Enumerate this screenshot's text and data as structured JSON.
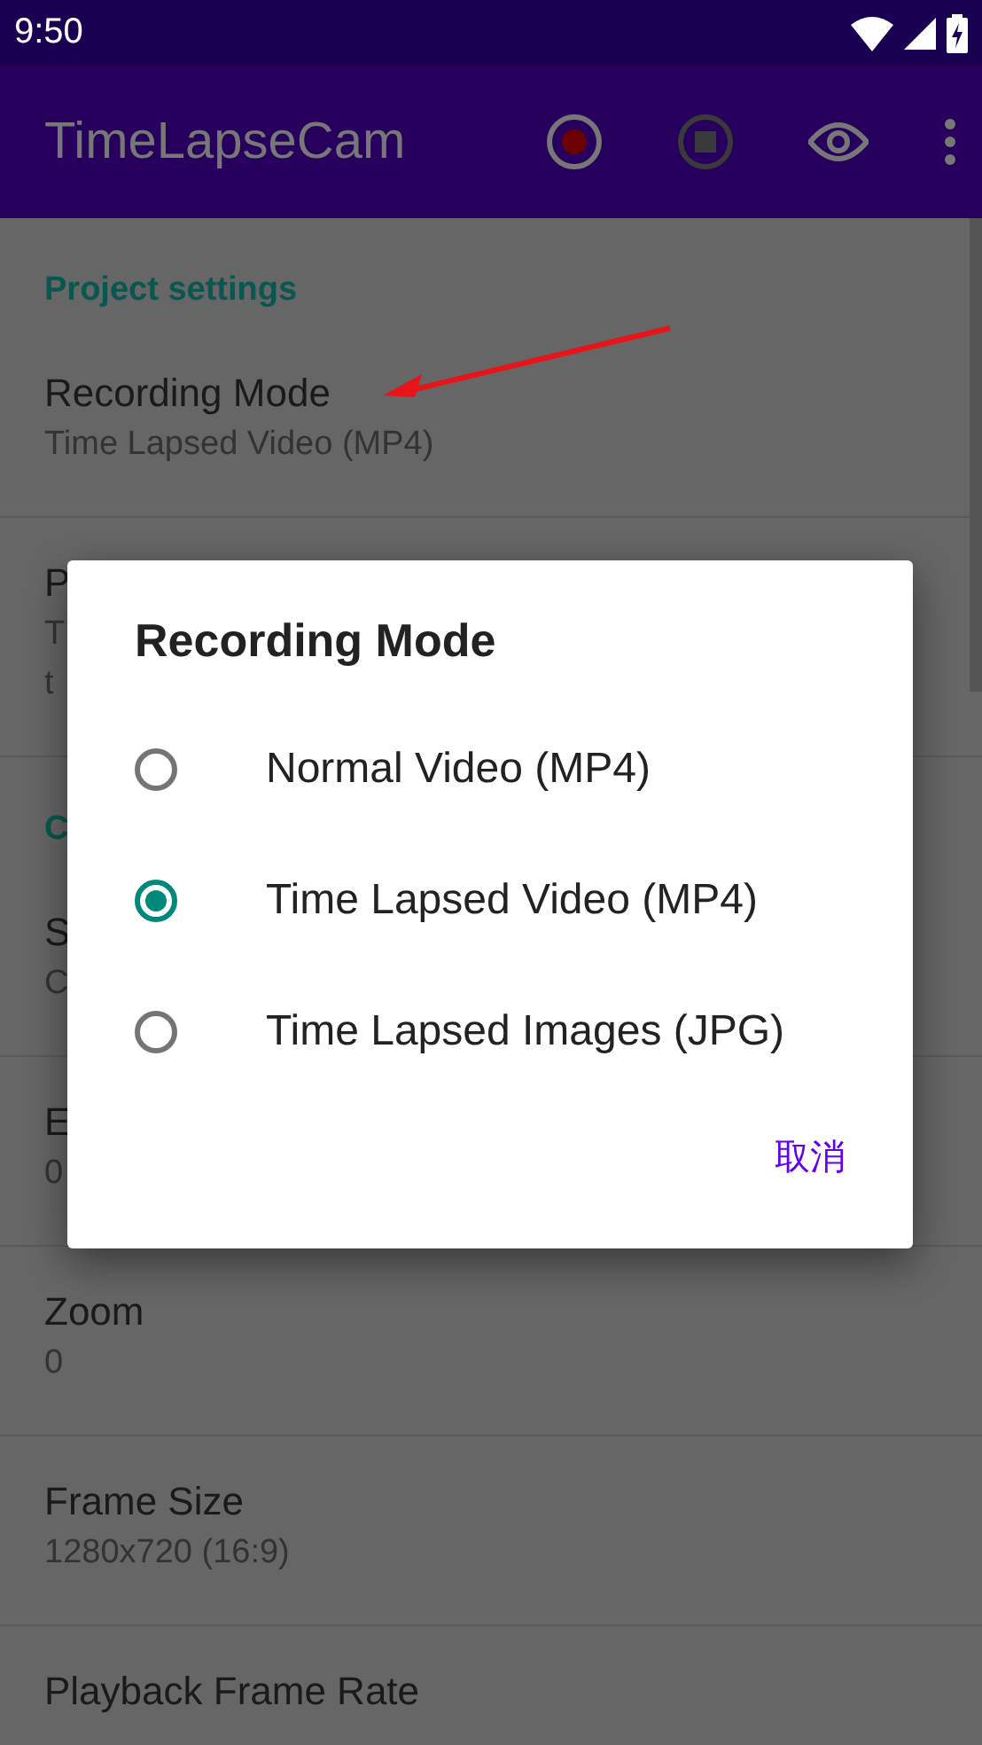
{
  "status_bar": {
    "time": "9:50"
  },
  "app_bar": {
    "title": "TimeLapseCam"
  },
  "sections": [
    {
      "header": "Project settings",
      "items": [
        {
          "title": "Recording Mode",
          "summary": [
            "Time Lapsed Video (MP4)"
          ]
        },
        {
          "title": "P",
          "summary": [
            "T",
            "t"
          ]
        }
      ]
    },
    {
      "header": "C",
      "items": [
        {
          "title": "S",
          "summary": [
            "C"
          ]
        },
        {
          "title": "E",
          "summary": [
            "0"
          ]
        },
        {
          "title": "Zoom",
          "summary": [
            "0"
          ]
        },
        {
          "title": "Frame Size",
          "summary": [
            "1280x720 (16:9)"
          ]
        },
        {
          "title": "Playback Frame Rate"
        }
      ]
    }
  ],
  "dialog": {
    "title": "Recording Mode",
    "options": [
      {
        "label": "Normal Video (MP4)",
        "selected": false
      },
      {
        "label": "Time Lapsed Video (MP4)",
        "selected": true
      },
      {
        "label": "Time Lapsed Images (JPG)",
        "selected": false
      }
    ],
    "cancel": "取消"
  }
}
